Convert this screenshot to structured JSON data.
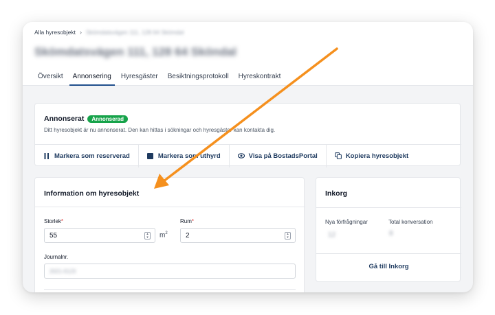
{
  "header": {
    "breadcrumb": {
      "root": "Alla hyresobjekt",
      "separator": "›",
      "current": "Skömdatsvägen 111, 128 64 Skömdal"
    },
    "title": "Skömdatsvägen 111, 128 64 Sköndal",
    "tabs": [
      {
        "label": "Översikt",
        "active": false
      },
      {
        "label": "Annonsering",
        "active": true
      },
      {
        "label": "Hyresgäster",
        "active": false
      },
      {
        "label": "Besiktningsprotokoll",
        "active": false
      },
      {
        "label": "Hyreskontrakt",
        "active": false
      }
    ]
  },
  "status": {
    "title": "Annonserat",
    "badge": "Annonserad",
    "badge_color": "#16a34a",
    "description": "Ditt hyresobjekt är nu annonserat. Den kan hittas i sökningar och hyresgäster kan kontakta dig.",
    "actions": [
      {
        "label": "Markera som reserverad",
        "icon": "pause-icon"
      },
      {
        "label": "Markera som uthyrd",
        "icon": "square-icon"
      },
      {
        "label": "Visa på BostadsPortal",
        "icon": "eye-icon"
      },
      {
        "label": "Kopiera hyresobjekt",
        "icon": "copy-icon"
      }
    ]
  },
  "info": {
    "title": "Information om hyresobjekt",
    "size_label": "Storlek",
    "size_value": "55",
    "size_unit": "m",
    "size_unit_exp": "2",
    "rooms_label": "Rum",
    "rooms_value": "2",
    "required_mark": "*",
    "journal_label": "Journalnr.",
    "journal_value": "2021-0123"
  },
  "inbox": {
    "title": "Inkorg",
    "new_requests_label": "Nya förfrågningar",
    "new_requests_value": "12",
    "total_label": "Total konversation",
    "total_value": "8",
    "link": "Gå till Inkorg"
  },
  "annotation": {
    "arrow_color": "#f5901e"
  }
}
